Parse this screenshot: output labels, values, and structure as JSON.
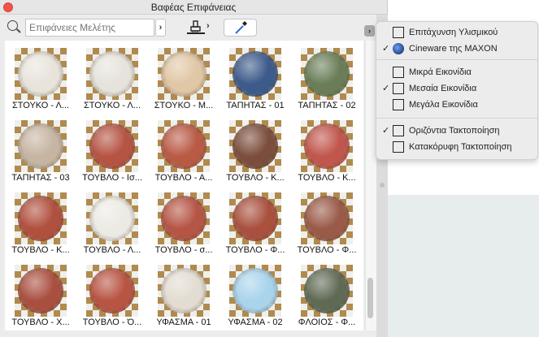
{
  "window": {
    "title": "Βαφέας Επιφάνειας"
  },
  "toolbar": {
    "search_placeholder": "Επιφάνειες Μελέτης",
    "chevron": "›"
  },
  "colors": {
    "accent": "#2a6fd6",
    "close": "#f0524c"
  },
  "materials": [
    {
      "label": "ΣΤΟΥΚΟ - Λ...",
      "color": "#e8e4dc"
    },
    {
      "label": "ΣΤΟΥΚΟ - Λ...",
      "color": "#e6e3dc"
    },
    {
      "label": "ΣΤΟΥΚΟ - Μ...",
      "color": "#e0c7a6"
    },
    {
      "label": "ΤΑΠΗΤΑΣ - 01",
      "color": "#3c5a8a"
    },
    {
      "label": "ΤΑΠΗΤΑΣ - 02",
      "color": "#6a7d58"
    },
    {
      "label": "ΤΑΠΗΤΑΣ - 03",
      "color": "#c6b5a2"
    },
    {
      "label": "ΤΟΥΒΛΟ - Ισ...",
      "color": "#b55443"
    },
    {
      "label": "ΤΟΥΒΛΟ - Α...",
      "color": "#b95a45"
    },
    {
      "label": "ΤΟΥΒΛΟ - Κ...",
      "color": "#7b4d3c"
    },
    {
      "label": "ΤΟΥΒΛΟ - Κ...",
      "color": "#c0564c"
    },
    {
      "label": "ΤΟΥΒΛΟ - Κ...",
      "color": "#b0503e"
    },
    {
      "label": "ΤΟΥΒΛΟ - Λ...",
      "color": "#eceae4"
    },
    {
      "label": "ΤΟΥΒΛΟ - σ...",
      "color": "#b55545"
    },
    {
      "label": "ΤΟΥΒΛΟ - Φ...",
      "color": "#a9503e"
    },
    {
      "label": "ΤΟΥΒΛΟ - Φ...",
      "color": "#9a5a48"
    },
    {
      "label": "ΤΟΥΒΛΟ - Χ...",
      "color": "#a94f40"
    },
    {
      "label": "ΤΟΥΒΛΟ - Ό...",
      "color": "#b85443"
    },
    {
      "label": "ΥΦΑΣΜΑ - 01",
      "color": "#e2dcd2"
    },
    {
      "label": "ΥΦΑΣΜΑ - 02",
      "color": "#a9d4ec"
    },
    {
      "label": "ΦΛΟΙΟΣ - Φ...",
      "color": "#5f6a55"
    }
  ],
  "menu": {
    "items": [
      {
        "label": "Επιτάχυνση Υλισμικού",
        "checked": false,
        "icon": "cube-icon"
      },
      {
        "label": "Cineware της MAXON",
        "checked": true,
        "icon": "cineware-logo-icon"
      },
      {
        "label": "Μικρά Εικονίδια",
        "checked": false,
        "icon": "list-icon"
      },
      {
        "label": "Μεσαία Εικονίδια",
        "checked": true,
        "icon": "grid-icon"
      },
      {
        "label": "Μεγάλα Εικονίδια",
        "checked": false,
        "icon": "large-icon"
      },
      {
        "label": "Οριζόντια Τακτοποίηση",
        "checked": true,
        "icon": "split-horizontal-icon"
      },
      {
        "label": "Κατακόρυφη Τακτοποίηση",
        "checked": false,
        "icon": "split-vertical-icon"
      }
    ],
    "check": "✓"
  }
}
